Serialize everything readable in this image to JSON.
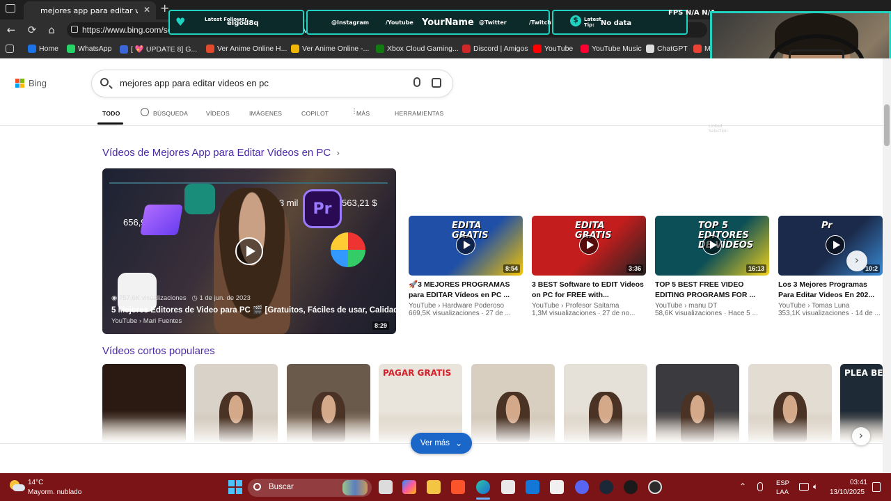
{
  "browser": {
    "tab_title": "mejores app para editar videos en",
    "url": "https://www.bing.com/search?q=mejores+app+para+editar+videos+en+pc&form=",
    "bookmarks": [
      {
        "label": "Home",
        "color": "#1a73e8"
      },
      {
        "label": "WhatsApp",
        "color": "#25d366"
      },
      {
        "label": "[ 💖 UPDATE 8] G...",
        "color": "#3b66d6"
      },
      {
        "label": "Ver Anime Online H...",
        "color": "#e04a2a"
      },
      {
        "label": "Ver Anime Online -...",
        "color": "#f2b705"
      },
      {
        "label": "Xbox Cloud Gaming...",
        "color": "#107c10"
      },
      {
        "label": "Discord | Amigos",
        "color": "#d02828"
      },
      {
        "label": "YouTube",
        "color": "#ff0000"
      },
      {
        "label": "YouTube Music",
        "color": "#ff0033"
      },
      {
        "label": "ChatGPT",
        "color": "#dddddd"
      },
      {
        "label": "M",
        "color": "#ea4335"
      }
    ]
  },
  "overlay": {
    "latest_follower_label": "Latest Follower",
    "latest_follower": "elgod8q",
    "instagram": "@Instagram",
    "youtube": "/Youtube",
    "your_name": "YourName",
    "twitter": "@Twitter",
    "twitch": "/Twitch",
    "latest_tip_label": "Latest Tip:",
    "latest_tip": "No data",
    "fps_label": "FPS",
    "fps_value": "N/A",
    "fps_value2": "N/A"
  },
  "bing": {
    "logo_text": "Bing",
    "query": "mejores app para editar videos en pc",
    "tabs": [
      "TODO",
      "BÚSQUEDA",
      "VÍDEOS",
      "IMÁGENES",
      "COPILOT",
      "MÁS",
      "HERRAMIENTAS"
    ],
    "section_videos_title": "Vídeos de Mejores App para Editar Videos en PC",
    "featured": {
      "stat1": "656,9 mil",
      "stat2": "3 mil",
      "stat3": "563,21 $",
      "views": "757,6K visualizaciones",
      "date": "1 de jun. de 2023",
      "title": "5 Mejores Editores de Video para PC 🎬 [Gratuitos, Fáciles de usar, Calidad...]",
      "source": "YouTube › Mari Fuentes",
      "duration": "8:29"
    },
    "cards": [
      {
        "title": "🚀3 MEJORES PROGRAMAS para EDITAR Vídeos en PC ...",
        "source": "YouTube › Hardware Poderoso",
        "meta": "669,5K visualizaciones · 27 de ...",
        "duration": "8:54",
        "overlay_text": "EDITA GRATIS",
        "color1": "#1f4fa6",
        "color2": "#f5c400"
      },
      {
        "title": "3 BEST Software to EDIT Videos on PC for FREE with...",
        "source": "YouTube › Profesor Saitama",
        "meta": "1,3M visualizaciones · 27 de no...",
        "duration": "3:36",
        "overlay_text": "EDITA GRATIS",
        "color1": "#c41d1d",
        "color2": "#222222"
      },
      {
        "title": "TOP 5 BEST FREE VIDEO EDITING PROGRAMS FOR ...",
        "source": "YouTube › manu DT",
        "meta": "58,6K visualizaciones · Hace 5 ...",
        "duration": "16:13",
        "overlay_text": "TOP 5 EDITORES DE VÍDEOS",
        "color1": "#0d4f57",
        "color2": "#f2d21b"
      },
      {
        "title": "Los 3 Mejores Programas Para Editar Videos En 202...",
        "source": "YouTube › Tomas Luna",
        "meta": "353,1K visualizaciones · 14 de ...",
        "duration": "10:2",
        "overlay_text": "Pr",
        "color1": "#1b2a4a",
        "color2": "#3a8bd6"
      }
    ],
    "section_shorts_title": "Vídeos cortos populares",
    "shorts": [
      {
        "color": "#2a1a12",
        "text": ""
      },
      {
        "color": "#d9d2c8",
        "text": ""
      },
      {
        "color": "#6a5a4c",
        "text": ""
      },
      {
        "color": "#e9e5dc",
        "text": "PAGAR GRATIS"
      },
      {
        "color": "#d8cfc1",
        "text": ""
      },
      {
        "color": "#e6e1d8",
        "text": ""
      },
      {
        "color": "#3b3b3f",
        "text": ""
      },
      {
        "color": "#e2dcd2",
        "text": ""
      },
      {
        "color": "#1e2a35",
        "text": "PLEA BE KIN"
      }
    ],
    "ver_mas": "Ver más",
    "faded_text": "Linked Selection"
  },
  "taskbar": {
    "temp": "14°C",
    "weather": "Mayorm. nublado",
    "search_placeholder": "Buscar",
    "lang1": "ESP",
    "lang2": "LAA",
    "time": "03:41",
    "date": "13/10/2025"
  }
}
